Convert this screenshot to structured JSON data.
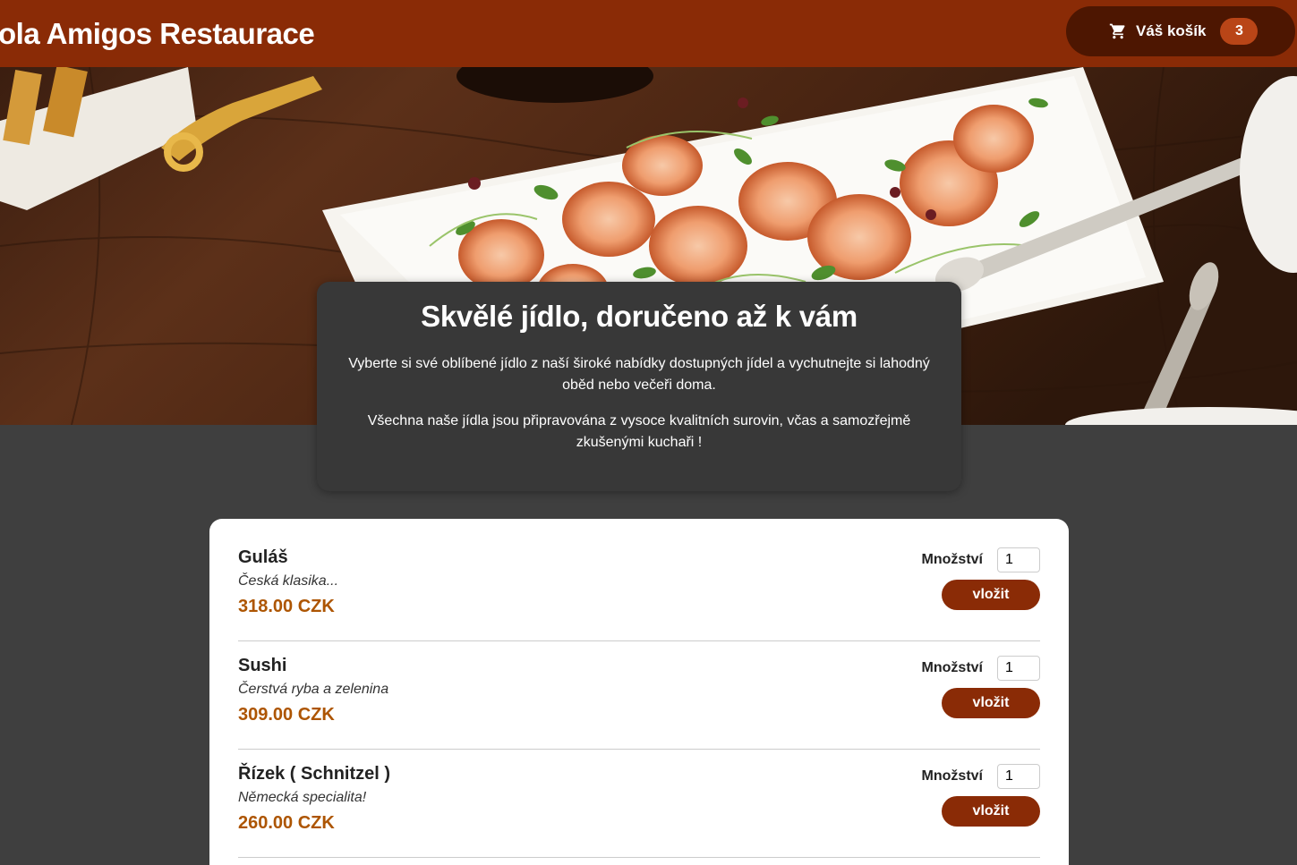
{
  "header": {
    "title": "ola Amigos Restaurace",
    "cart_label": "Váš košík",
    "cart_count": "3"
  },
  "summary": {
    "title": "Skvělé jídlo, doručeno až k vám",
    "paragraph1": "Vyberte si své oblíbené jídlo z naší široké nabídky dostupných jídel a vychutnejte si lahodný oběd nebo večeři doma.",
    "paragraph2": "Všechna naše jídla jsou připravována z vysoce kvalitních surovin, včas a samozřejmě zkušenými kuchaři !"
  },
  "meals": [
    {
      "name": "Guláš",
      "description": "Česká klasika...",
      "price": "318.00 CZK",
      "qty_label": "Množství",
      "qty": "1",
      "button": "vložit"
    },
    {
      "name": "Sushi",
      "description": "Čerstvá ryba a zelenina",
      "price": "309.00 CZK",
      "qty_label": "Množství",
      "qty": "1",
      "button": "vložit"
    },
    {
      "name": "Řízek ( Schnitzel )",
      "description": "Německá specialita!",
      "price": "260.00 CZK",
      "qty_label": "Množství",
      "qty": "1",
      "button": "vložit"
    }
  ],
  "colors": {
    "header": "#8a2b06",
    "cart_button": "#4d1601",
    "badge": "#b94517",
    "price": "#ad5502",
    "background": "#3f3f3f"
  },
  "icons": {
    "cart": "shopping-cart-icon"
  }
}
